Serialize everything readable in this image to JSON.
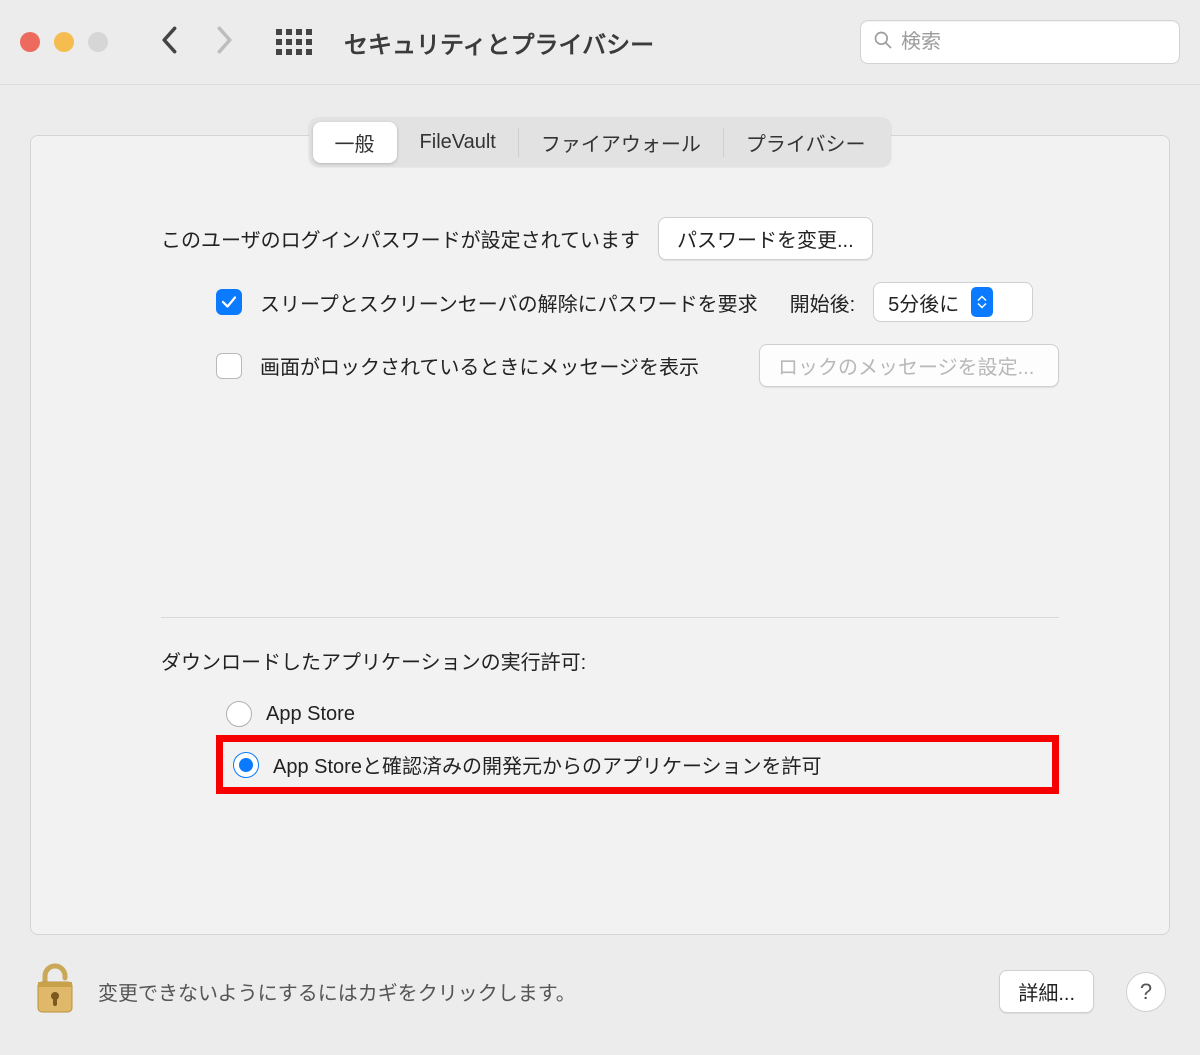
{
  "header": {
    "title": "セキュリティとプライバシー",
    "search_placeholder": "検索"
  },
  "tabs": [
    {
      "label": "一般",
      "active": true
    },
    {
      "label": "FileVault",
      "active": false
    },
    {
      "label": "ファイアウォール",
      "active": false
    },
    {
      "label": "プライバシー",
      "active": false
    }
  ],
  "general": {
    "password_set_text": "このユーザのログインパスワードが設定されています",
    "change_password_button": "パスワードを変更...",
    "require_pw_checkbox": {
      "checked": true,
      "label": "スリープとスクリーンセーバの解除にパスワードを要求",
      "after_label": "開始後:",
      "select_value": "5分後に"
    },
    "lock_message_checkbox": {
      "checked": false,
      "label": "画面がロックされているときにメッセージを表示",
      "set_message_button": "ロックのメッセージを設定...",
      "set_message_disabled": true
    },
    "allow_apps_title": "ダウンロードしたアプリケーションの実行許可:",
    "allow_apps_options": [
      {
        "label": "App Store",
        "selected": false
      },
      {
        "label": "App Storeと確認済みの開発元からのアプリケーションを許可",
        "selected": true,
        "highlighted": true
      }
    ]
  },
  "footer": {
    "lock_text": "変更できないようにするにはカギをクリックします。",
    "details_button": "詳細...",
    "help": "?"
  },
  "colors": {
    "accent": "#0a7aff",
    "highlight": "#f60000"
  }
}
